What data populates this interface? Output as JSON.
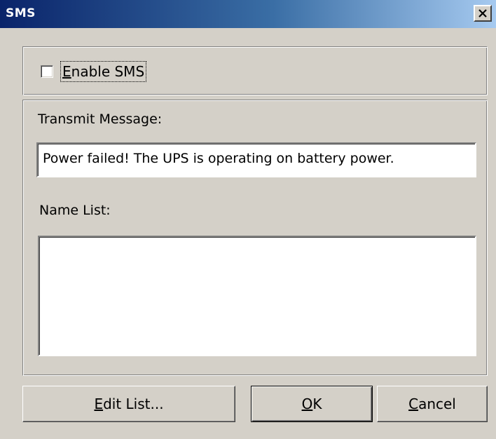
{
  "window": {
    "title": "SMS",
    "close_glyph": "×"
  },
  "enable_sms": {
    "label_accel": "E",
    "label_rest": "nable SMS",
    "checked": false
  },
  "transmit": {
    "label": "Transmit Message:",
    "value": "Power failed! The UPS is operating on battery power."
  },
  "name_list": {
    "label": "Name List:",
    "items": []
  },
  "buttons": {
    "edit_accel": "E",
    "edit_rest": "dit List...",
    "ok_accel": "O",
    "ok_rest": "K",
    "cancel_accel": "C",
    "cancel_rest": "ancel"
  },
  "icons": {
    "close": "close-icon",
    "checkbox": "checkbox-unchecked"
  }
}
